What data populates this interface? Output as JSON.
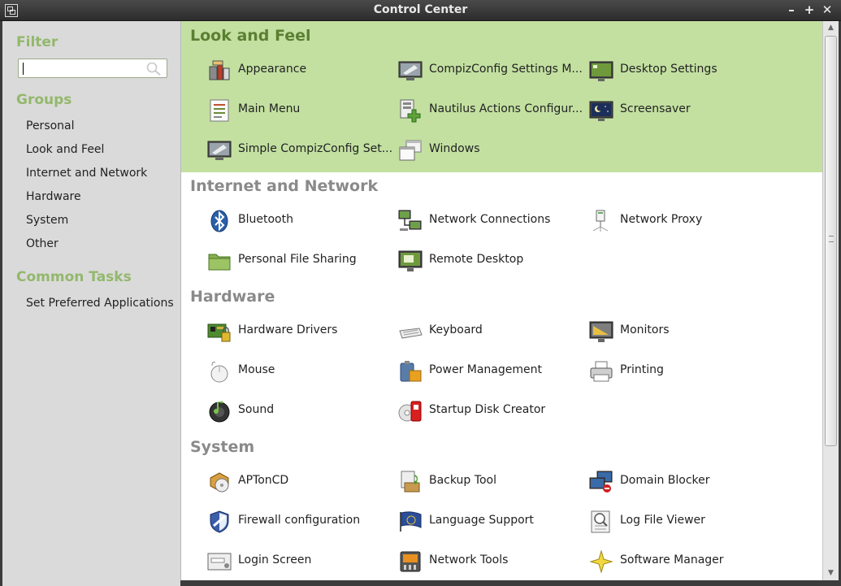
{
  "window": {
    "title": "Control Center",
    "buttons": {
      "minimize": "–",
      "maximize": "+",
      "close": "✕"
    }
  },
  "sidebar": {
    "filter_heading": "Filter",
    "filter_value": "",
    "groups_heading": "Groups",
    "groups": [
      "Personal",
      "Look and Feel",
      "Internet and Network",
      "Hardware",
      "System",
      "Other"
    ],
    "tasks_heading": "Common Tasks",
    "tasks": [
      "Set Preferred Applications"
    ]
  },
  "sections": [
    {
      "title": "Look and Feel",
      "highlighted": true,
      "items": [
        {
          "label": "Appearance",
          "icon": "appearance-icon"
        },
        {
          "label": "CompizConfig Settings M...",
          "icon": "compizconfig-icon"
        },
        {
          "label": "Desktop Settings",
          "icon": "desktop-settings-icon"
        },
        {
          "label": "Main Menu",
          "icon": "main-menu-icon"
        },
        {
          "label": "Nautilus Actions Configur...",
          "icon": "nautilus-actions-icon"
        },
        {
          "label": "Screensaver",
          "icon": "screensaver-icon"
        },
        {
          "label": "Simple CompizConfig Set...",
          "icon": "simple-compizconfig-icon"
        },
        {
          "label": "Windows",
          "icon": "windows-icon"
        }
      ]
    },
    {
      "title": "Internet and Network",
      "highlighted": false,
      "items": [
        {
          "label": "Bluetooth",
          "icon": "bluetooth-icon"
        },
        {
          "label": "Network Connections",
          "icon": "network-connections-icon"
        },
        {
          "label": "Network Proxy",
          "icon": "network-proxy-icon"
        },
        {
          "label": "Personal File Sharing",
          "icon": "folder-icon"
        },
        {
          "label": "Remote Desktop",
          "icon": "remote-desktop-icon"
        }
      ]
    },
    {
      "title": "Hardware",
      "highlighted": false,
      "items": [
        {
          "label": "Hardware Drivers",
          "icon": "hardware-drivers-icon"
        },
        {
          "label": "Keyboard",
          "icon": "keyboard-icon"
        },
        {
          "label": "Monitors",
          "icon": "monitors-icon"
        },
        {
          "label": "Mouse",
          "icon": "mouse-icon"
        },
        {
          "label": "Power Management",
          "icon": "power-management-icon"
        },
        {
          "label": "Printing",
          "icon": "printer-icon"
        },
        {
          "label": "Sound",
          "icon": "sound-icon"
        },
        {
          "label": "Startup Disk Creator",
          "icon": "startup-disk-icon"
        }
      ]
    },
    {
      "title": "System",
      "highlighted": false,
      "items": [
        {
          "label": "APTonCD",
          "icon": "aptoncd-icon"
        },
        {
          "label": "Backup Tool",
          "icon": "backup-icon"
        },
        {
          "label": "Domain Blocker",
          "icon": "domain-blocker-icon"
        },
        {
          "label": "Firewall configuration",
          "icon": "firewall-icon"
        },
        {
          "label": "Language Support",
          "icon": "language-support-icon"
        },
        {
          "label": "Log File Viewer",
          "icon": "log-viewer-icon"
        },
        {
          "label": "Login Screen",
          "icon": "login-screen-icon"
        },
        {
          "label": "Network Tools",
          "icon": "network-tools-icon"
        },
        {
          "label": "Software Manager",
          "icon": "software-manager-icon"
        }
      ]
    }
  ],
  "colors": {
    "accent_green": "#93b86c",
    "section_highlight": "#c3e0a1",
    "active_section_title": "#5a7f32",
    "inactive_section_title": "#8a8a8a"
  }
}
